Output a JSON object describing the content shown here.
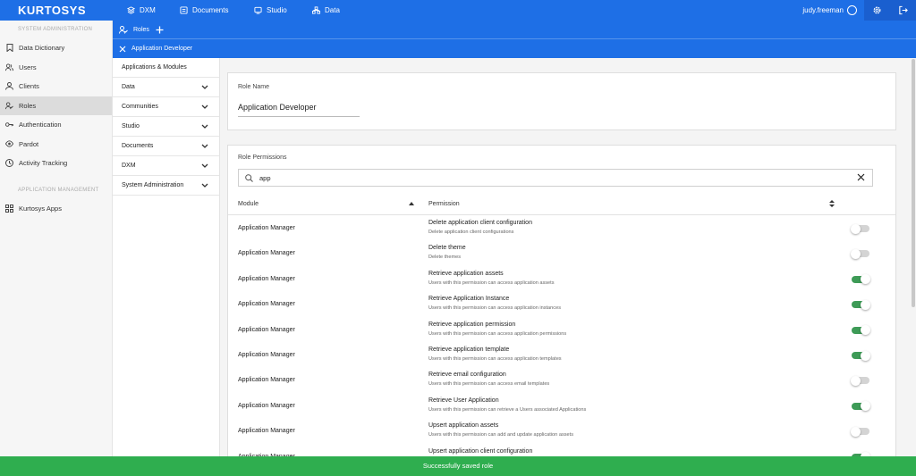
{
  "app": {
    "logo": "KURTOSYS"
  },
  "topnav": [
    {
      "label": "DXM",
      "icon": "layers-icon"
    },
    {
      "label": "Documents",
      "icon": "documents-icon"
    },
    {
      "label": "Studio",
      "icon": "studio-icon"
    },
    {
      "label": "Data",
      "icon": "data-icon"
    }
  ],
  "user": {
    "name": "judy.freeman"
  },
  "sidebar": {
    "section1": "SYSTEM ADMINISTRATION",
    "items1": [
      {
        "label": "Data Dictionary",
        "icon": "bookmark-icon"
      },
      {
        "label": "Users",
        "icon": "users-icon"
      },
      {
        "label": "Clients",
        "icon": "clients-icon"
      },
      {
        "label": "Roles",
        "icon": "roles-icon"
      },
      {
        "label": "Authentication",
        "icon": "key-icon"
      },
      {
        "label": "Pardot",
        "icon": "eye-icon"
      },
      {
        "label": "Activity Tracking",
        "icon": "clock-icon"
      }
    ],
    "section2": "APPLICATION MANAGEMENT",
    "items2": [
      {
        "label": "Kurtosys Apps",
        "icon": "grid-icon"
      }
    ]
  },
  "header": {
    "breadcrumb": "Roles",
    "current": "Application Developer"
  },
  "menu": [
    {
      "label": "Applications & Modules"
    },
    {
      "label": "Data"
    },
    {
      "label": "Communities"
    },
    {
      "label": "Studio"
    },
    {
      "label": "Documents"
    },
    {
      "label": "DXM"
    },
    {
      "label": "System Administration"
    }
  ],
  "role_name": {
    "label": "Role Name",
    "value": "Application Developer"
  },
  "permissions": {
    "label": "Role Permissions",
    "search_value": "app",
    "col_module": "Module",
    "col_permission": "Permission",
    "rows": [
      {
        "module": "Application Manager",
        "title": "Delete application client configuration",
        "desc": "Delete application client configurations",
        "enabled": false
      },
      {
        "module": "Application Manager",
        "title": "Delete theme",
        "desc": "Delete themes",
        "enabled": false
      },
      {
        "module": "Application Manager",
        "title": "Retrieve application assets",
        "desc": "Users with this permission can access application assets",
        "enabled": true
      },
      {
        "module": "Application Manager",
        "title": "Retrieve Application Instance",
        "desc": "Users with this permission can access application instances",
        "enabled": true
      },
      {
        "module": "Application Manager",
        "title": "Retrieve application permission",
        "desc": "Users with this permission can access application permissions",
        "enabled": true
      },
      {
        "module": "Application Manager",
        "title": "Retrieve application template",
        "desc": "Users with this permission can access application templates",
        "enabled": true
      },
      {
        "module": "Application Manager",
        "title": "Retrieve email configuration",
        "desc": "Users with this permission can access email templates",
        "enabled": false
      },
      {
        "module": "Application Manager",
        "title": "Retrieve User Application",
        "desc": "Users with this permission can retrieve a Users associated Applications",
        "enabled": true
      },
      {
        "module": "Application Manager",
        "title": "Upsert application assets",
        "desc": "Users with this permission can add and update application assets",
        "enabled": false
      },
      {
        "module": "Application Manager",
        "title": "Upsert application client configuration",
        "desc": "",
        "enabled": true
      }
    ]
  },
  "toast": {
    "message": "Successfully saved role"
  },
  "colors": {
    "primary": "#1e6fe6",
    "success": "#2fae4f",
    "toggle_on": "#3e9b57"
  }
}
